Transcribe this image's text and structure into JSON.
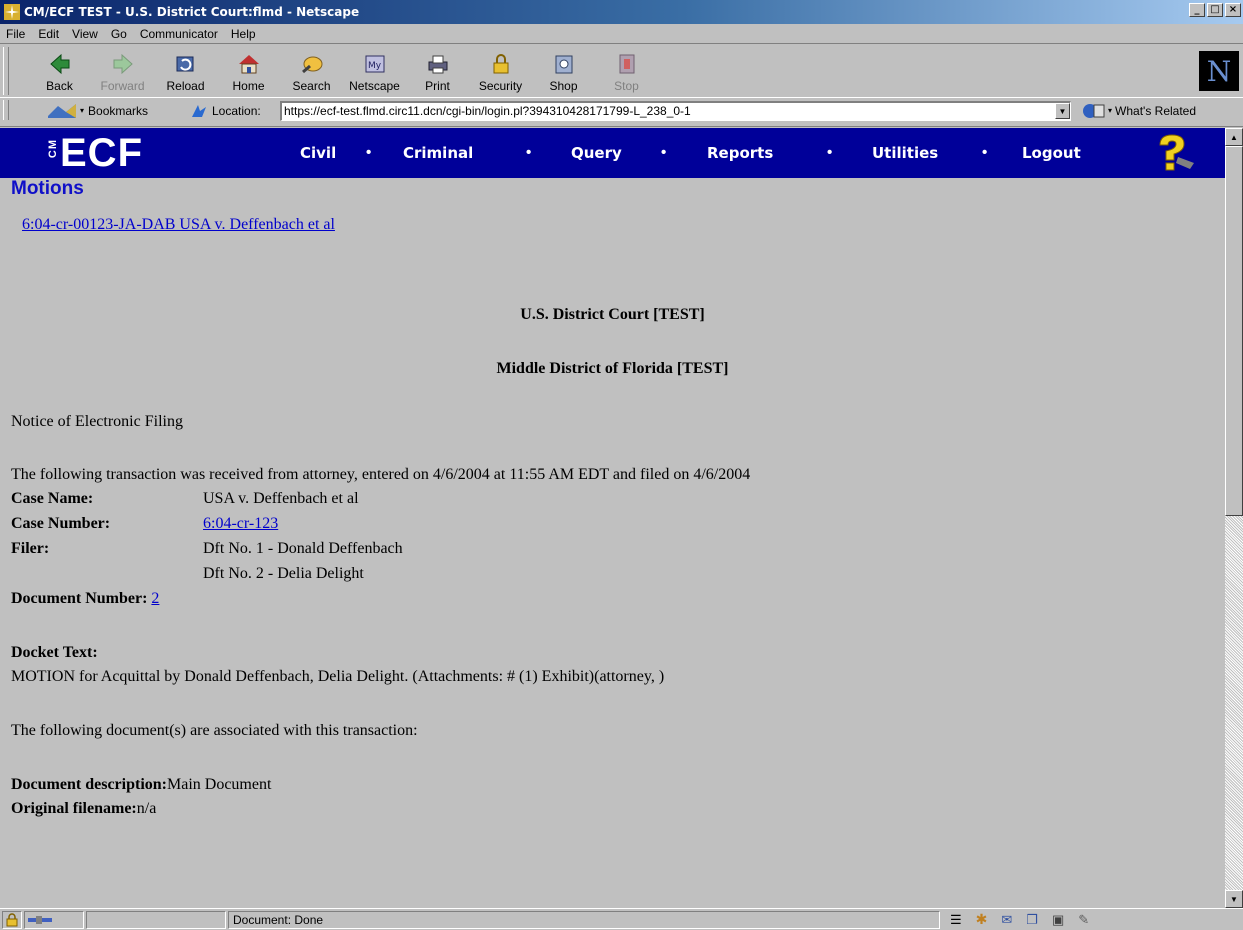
{
  "window": {
    "title": "CM/ECF TEST - U.S. District Court:flmd - Netscape",
    "controls": [
      "_",
      "□",
      "×"
    ]
  },
  "menu": [
    "File",
    "Edit",
    "View",
    "Go",
    "Communicator",
    "Help"
  ],
  "toolbar": {
    "buttons": [
      {
        "label": "Back",
        "icon": "back-arrow-icon",
        "enabled": true
      },
      {
        "label": "Forward",
        "icon": "forward-arrow-icon",
        "enabled": false
      },
      {
        "label": "Reload",
        "icon": "reload-icon",
        "enabled": true
      },
      {
        "label": "Home",
        "icon": "home-icon",
        "enabled": true
      },
      {
        "label": "Search",
        "icon": "search-icon",
        "enabled": true
      },
      {
        "label": "Netscape",
        "icon": "my-netscape-icon",
        "enabled": true
      },
      {
        "label": "Print",
        "icon": "print-icon",
        "enabled": true
      },
      {
        "label": "Security",
        "icon": "lock-icon",
        "enabled": true
      },
      {
        "label": "Shop",
        "icon": "shop-icon",
        "enabled": true
      },
      {
        "label": "Stop",
        "icon": "stop-icon",
        "enabled": false
      }
    ],
    "logo": "N"
  },
  "location": {
    "bookmarks_label": "Bookmarks",
    "location_label": "Location:",
    "url": "https://ecf-test.flmd.circ11.dcn/cgi-bin/login.pl?394310428171799-L_238_0-1",
    "related_label": "What's Related"
  },
  "ecf_nav": {
    "logo": "ECF",
    "logo_prefix": "CM",
    "items": [
      "Civil",
      "Criminal",
      "Query",
      "Reports",
      "Utilities",
      "Logout"
    ],
    "separator": "•"
  },
  "page": {
    "heading": "Motions",
    "case_link": "6:04-cr-00123-JA-DAB USA v. Deffenbach et al",
    "court": "U.S. District Court [TEST]",
    "district": "Middle District of Florida [TEST]",
    "notice": "Notice of Electronic Filing",
    "transaction": "The following transaction was received from attorney, entered on 4/6/2004 at 11:55 AM EDT and filed on 4/6/2004",
    "case_name_label": "Case Name:",
    "case_name": "USA v. Deffenbach et al",
    "case_number_label": "Case Number:",
    "case_number": "6:04-cr-123",
    "filer_label": "Filer:",
    "filers": [
      "Dft No. 1 - Donald Deffenbach",
      "Dft No. 2 - Delia Delight"
    ],
    "doc_number_label": "Document Number:",
    "doc_number": "2",
    "docket_text_label": "Docket Text:",
    "docket_text": "MOTION for Acquittal by Donald Deffenbach, Delia Delight. (Attachments: # (1) Exhibit)(attorney, )",
    "associated": "The following document(s) are associated with this transaction:",
    "doc_desc_label": "Document description:",
    "doc_desc": "Main Document",
    "orig_filename_label": "Original filename:",
    "orig_filename": "n/a"
  },
  "status": {
    "text": "Document: Done"
  }
}
